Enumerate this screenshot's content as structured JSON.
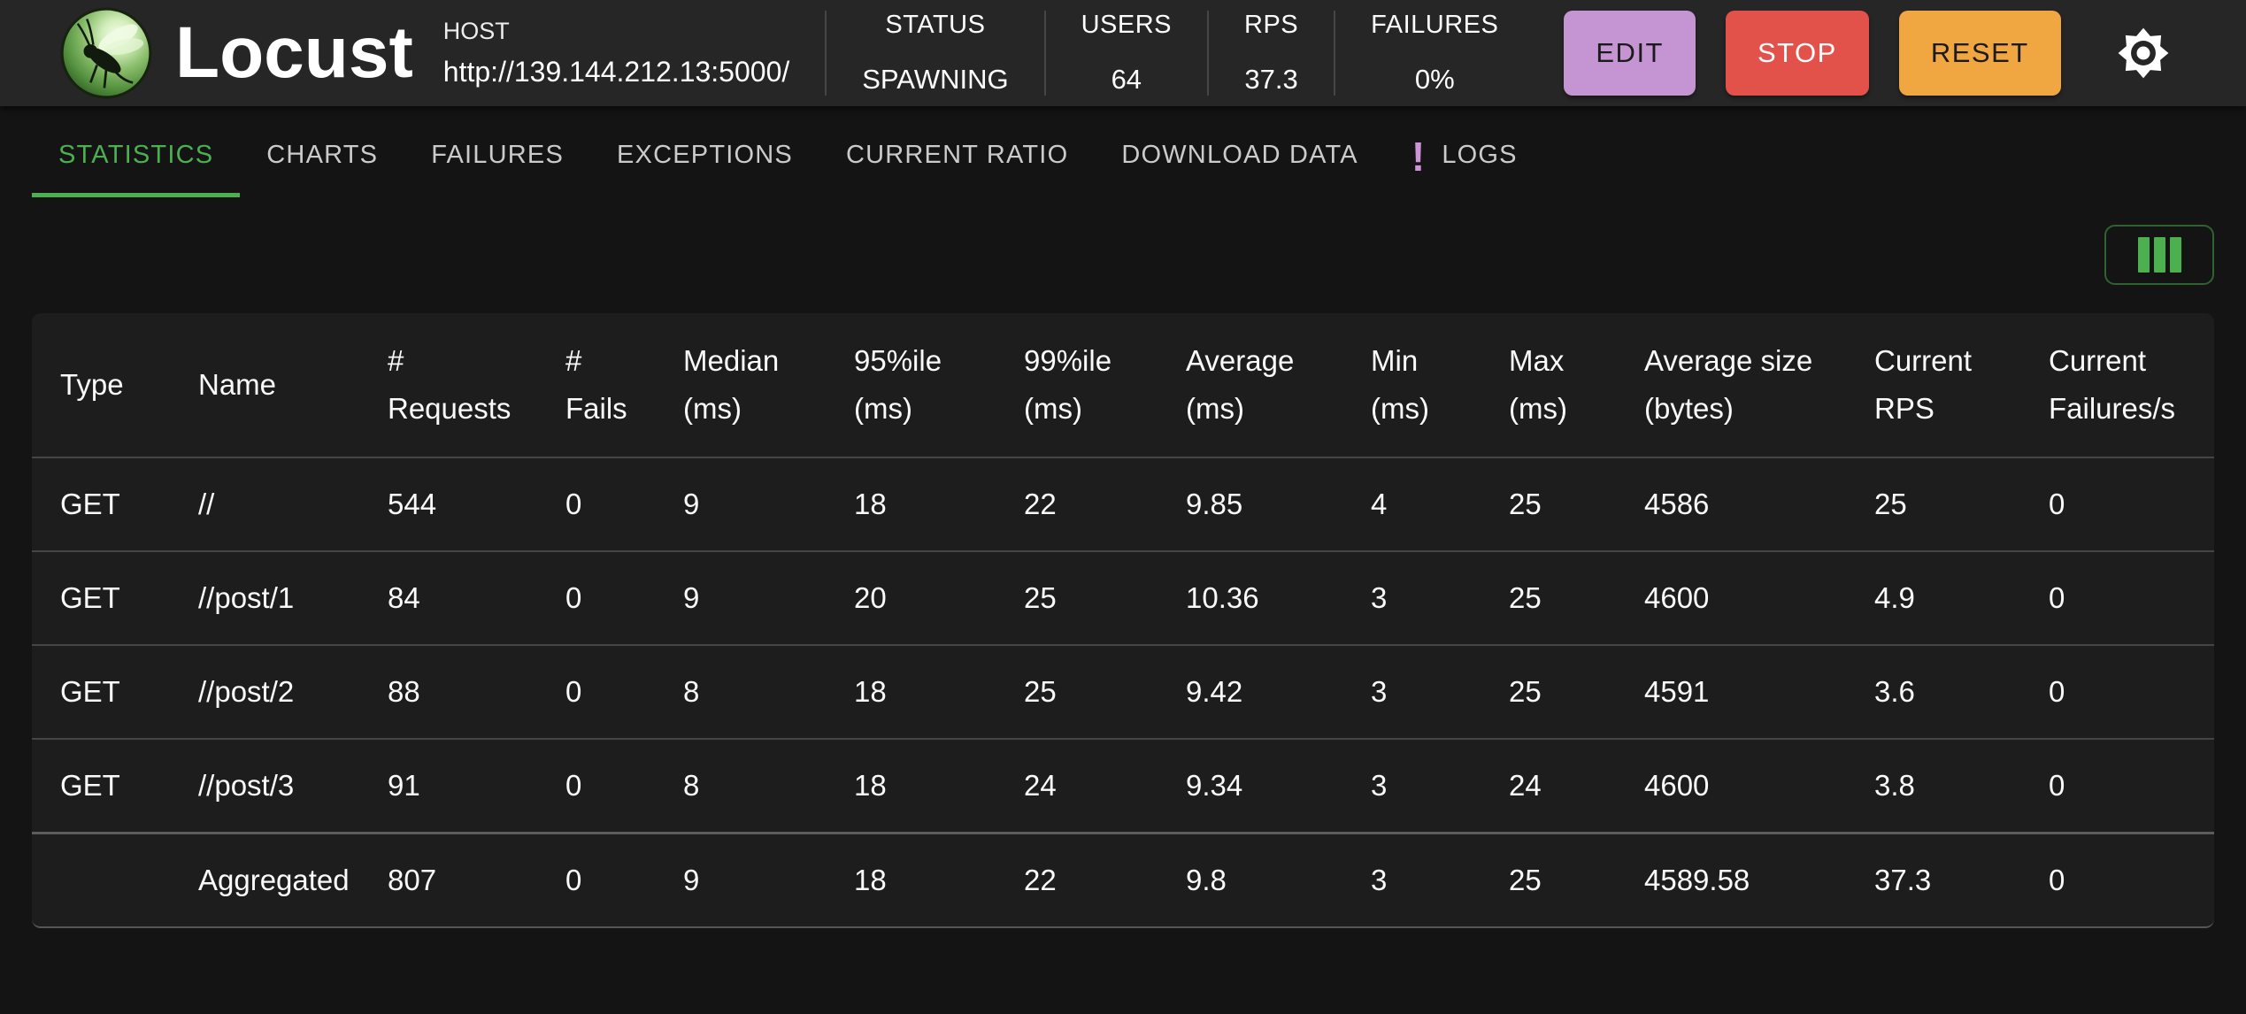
{
  "header": {
    "brand": "Locust",
    "host": {
      "label": "HOST",
      "url": "http://139.144.212.13:5000/"
    },
    "stats": [
      {
        "label": "STATUS",
        "value": "SPAWNING"
      },
      {
        "label": "USERS",
        "value": "64"
      },
      {
        "label": "RPS",
        "value": "37.3"
      },
      {
        "label": "FAILURES",
        "value": "0%"
      }
    ],
    "buttons": {
      "edit": "EDIT",
      "stop": "STOP",
      "reset": "RESET"
    }
  },
  "tabs": [
    {
      "label": "STATISTICS",
      "active": true
    },
    {
      "label": "CHARTS"
    },
    {
      "label": "FAILURES"
    },
    {
      "label": "EXCEPTIONS"
    },
    {
      "label": "CURRENT RATIO"
    },
    {
      "label": "DOWNLOAD DATA"
    },
    {
      "label": "LOGS",
      "badge": "!"
    }
  ],
  "table": {
    "columns": [
      {
        "key": "type",
        "line1": "Type",
        "line2": ""
      },
      {
        "key": "name",
        "line1": "Name",
        "line2": ""
      },
      {
        "key": "requests",
        "line1": "#",
        "line2": "Requests"
      },
      {
        "key": "fails",
        "line1": "#",
        "line2": "Fails"
      },
      {
        "key": "median",
        "line1": "Median",
        "line2": "(ms)"
      },
      {
        "key": "p95",
        "line1": "95%ile",
        "line2": "(ms)"
      },
      {
        "key": "p99",
        "line1": "99%ile",
        "line2": "(ms)"
      },
      {
        "key": "average",
        "line1": "Average",
        "line2": "(ms)"
      },
      {
        "key": "min",
        "line1": "Min",
        "line2": "(ms)"
      },
      {
        "key": "max",
        "line1": "Max",
        "line2": "(ms)"
      },
      {
        "key": "average-size",
        "line1": "Average size",
        "line2": "(bytes)"
      },
      {
        "key": "current-rps",
        "line1": "Current",
        "line2": "RPS"
      },
      {
        "key": "current-failures",
        "line1": "Current",
        "line2": "Failures/s"
      }
    ],
    "rows": [
      [
        "GET",
        "//",
        "544",
        "0",
        "9",
        "18",
        "22",
        "9.85",
        "4",
        "25",
        "4586",
        "25",
        "0"
      ],
      [
        "GET",
        "//post/1",
        "84",
        "0",
        "9",
        "20",
        "25",
        "10.36",
        "3",
        "25",
        "4600",
        "4.9",
        "0"
      ],
      [
        "GET",
        "//post/2",
        "88",
        "0",
        "8",
        "18",
        "25",
        "9.42",
        "3",
        "25",
        "4591",
        "3.6",
        "0"
      ],
      [
        "GET",
        "//post/3",
        "91",
        "0",
        "8",
        "18",
        "24",
        "9.34",
        "3",
        "24",
        "4600",
        "3.8",
        "0"
      ]
    ],
    "aggregated": [
      "",
      "Aggregated",
      "807",
      "0",
      "9",
      "18",
      "22",
      "9.8",
      "3",
      "25",
      "4589.58",
      "37.3",
      "0"
    ]
  },
  "colors": {
    "accent": "#4caf50",
    "edit": "#c495d2",
    "stop": "#e2524b",
    "reset": "#f0a742",
    "badge": "#ce93d8"
  }
}
